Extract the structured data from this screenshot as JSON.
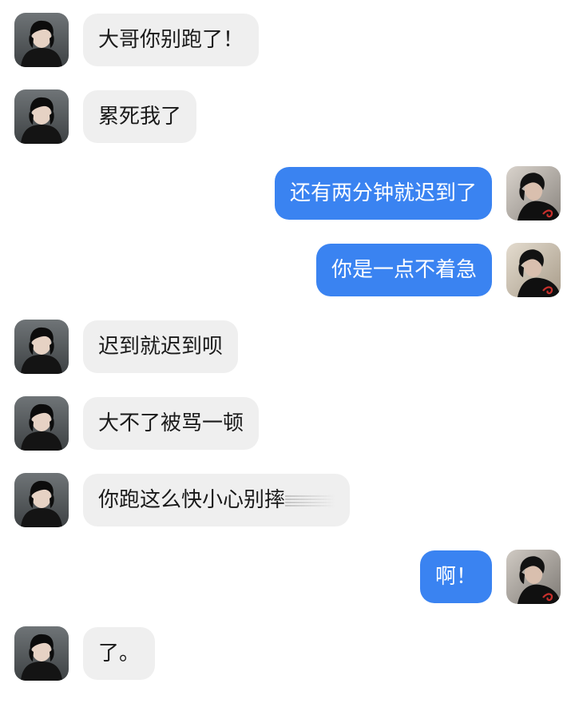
{
  "conversation": {
    "messages": [
      {
        "side": "left",
        "text": "大哥你别跑了！"
      },
      {
        "side": "left",
        "text": "累死我了"
      },
      {
        "side": "right",
        "text": "还有两分钟就迟到了"
      },
      {
        "side": "right",
        "text": "你是一点不着急"
      },
      {
        "side": "left",
        "text": "迟到就迟到呗"
      },
      {
        "side": "left",
        "text": "大不了被骂一顿"
      },
      {
        "side": "left",
        "text": "你跑这么快小心别摔"
      },
      {
        "side": "right",
        "text": "啊！"
      },
      {
        "side": "left",
        "text": "了。"
      }
    ]
  },
  "colors": {
    "incoming_bubble": "#efefef",
    "outgoing_bubble": "#3a83f1",
    "incoming_text": "#1a1a1a",
    "outgoing_text": "#ffffff"
  },
  "avatars": {
    "left": "contact-avatar-icon",
    "right": "self-avatar-icon"
  }
}
